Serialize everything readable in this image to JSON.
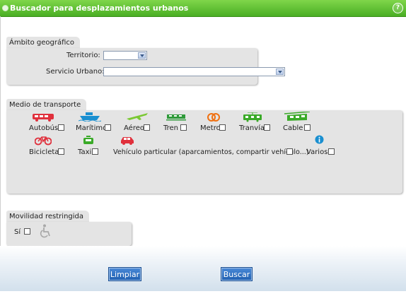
{
  "title": "Buscador para desplazamientos urbanos",
  "help_symbol": "?",
  "geo": {
    "section_label": "Ámbito geográfico",
    "territorio_label": "Territorio:",
    "territorio_value": "",
    "servicio_label": "Servicio Urbano:",
    "servicio_value": ""
  },
  "transport": {
    "section_label": "Medio de transporte",
    "modes": [
      {
        "label": "Autobús",
        "icon": "bus-icon",
        "color": "#e0303c"
      },
      {
        "label": "Marítimo",
        "icon": "ship-icon",
        "color": "#1a8fd0"
      },
      {
        "label": "Aéreo",
        "icon": "plane-icon",
        "color": "#7ac832"
      },
      {
        "label": "Tren",
        "icon": "train-icon",
        "color": "#2f9a3a"
      },
      {
        "label": "Metro",
        "icon": "metro-icon",
        "color": "#f07010"
      },
      {
        "label": "Tranvía",
        "icon": "tram-icon",
        "color": "#3aaa28"
      },
      {
        "label": "Cable",
        "icon": "cable-car-icon",
        "color": "#3aaa28"
      },
      {
        "label": "Bicicleta",
        "icon": "bicycle-icon",
        "color": "#e0303c"
      },
      {
        "label": "Taxi",
        "icon": "taxi-icon",
        "color": "#3aaa28"
      },
      {
        "label": "Vehículo particular (aparcamientos, compartir vehículo...)",
        "icon": "car-icon",
        "color": "#e0303c"
      },
      {
        "label": "Varios",
        "icon": "info-icon",
        "color": "#1a8fd0"
      }
    ]
  },
  "mobility": {
    "section_label": "Movilidad restringida",
    "yes_label": "Sí",
    "icon": "wheelchair-icon"
  },
  "buttons": {
    "clear": "Limpiar",
    "search": "Buscar"
  }
}
